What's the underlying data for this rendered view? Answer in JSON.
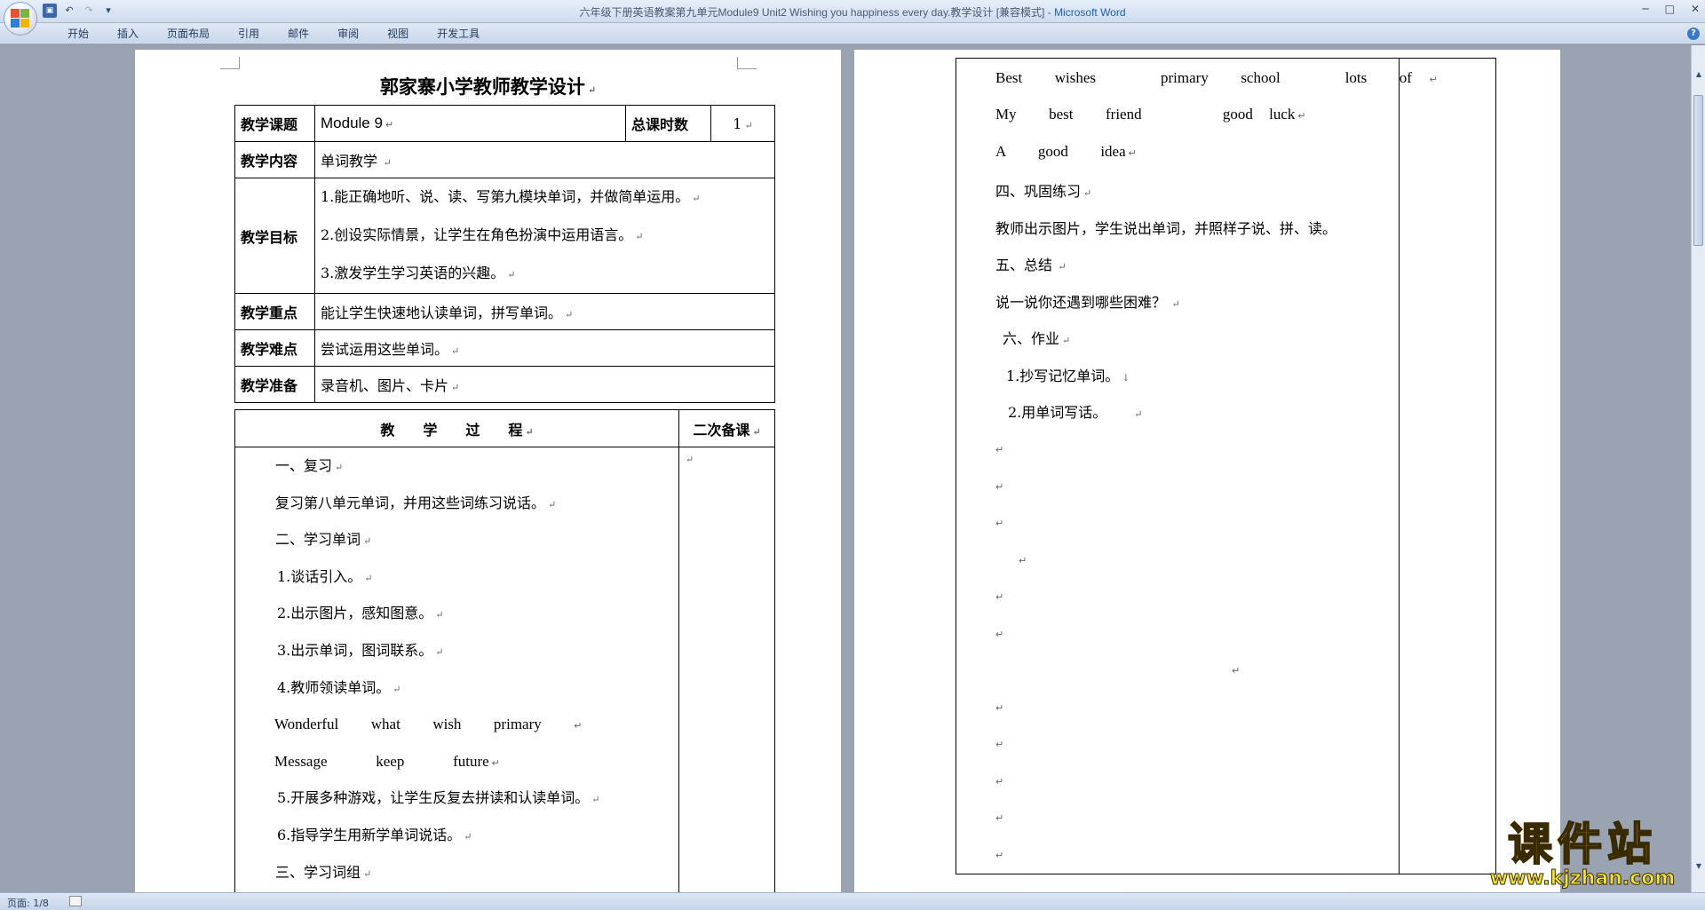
{
  "window": {
    "title_doc": "六年级下册英语教案第九单元Module9 Unit2 Wishing you happiness every day.教学设计 [兼容模式] - ",
    "title_app": "Microsoft Word",
    "minimize": "─",
    "maximize": "□",
    "close": "✕"
  },
  "quick_access": {
    "save_icon": "save-icon",
    "undo_glyph": "↶",
    "redo_glyph": "↷",
    "more_glyph": "▾"
  },
  "ribbon": {
    "tabs": [
      "开始",
      "插入",
      "页面布局",
      "引用",
      "邮件",
      "审阅",
      "视图",
      "开发工具"
    ],
    "help": "?"
  },
  "status": {
    "page": "页面: 1/8"
  },
  "left_page": {
    "doc_title": "郭家寨小学教师教学设计",
    "lesson_label": "教学课题",
    "lesson_value": "Module 9",
    "total_hours_label": "总课时数",
    "total_hours_value": "1",
    "content_label": "教学内容",
    "content_value": "单词教学",
    "goal_label": "教学目标",
    "goals": [
      "1.能正确地听、说、读、写第九模块单词，并做简单运用。",
      "2.创设实际情景，让学生在角色扮演中运用语言。",
      "3.激发学生学习英语的兴趣。"
    ],
    "key_label": "教学重点",
    "key_value": "能让学生快速地认读单词，拼写单词。",
    "difficulty_label": "教学难点",
    "difficulty_value": "尝试运用这些单词。",
    "prep_label": "教学准备",
    "prep_value": "录音机、图片、卡片",
    "process_header": "教　　学　　过　　程",
    "second_prep_header": "二次备课",
    "process_lines": [
      "一、复习",
      "复习第八单元单词，并用这些词练习说话。",
      "二、学习单词",
      "1.谈话引入。",
      "2.出示图片，感知图意。",
      "3.出示单词，图词联系。",
      "4.教师领读单词。",
      "Wonderful  what  wish  primary",
      "Message   keep   future",
      "5.开展多种游戏，让学生反复去拼读和认读单词。",
      "6.指导学生用新学单词说话。",
      "三、学习词组"
    ]
  },
  "right_page": {
    "lines": [
      "Best  wishes    primary  school    lots  of",
      "My  best  friend     good luck",
      "A  good  idea",
      "四、巩固练习",
      "教师出示图片，学生说出单词，并照样子说、拼、读。",
      "五、总结",
      "说一说你还遇到哪些困难？",
      "六、作业",
      "1.抄写记忆单词。",
      "2.用单词写话。"
    ]
  },
  "watermark": {
    "cn": "课件站",
    "url": "www.kjzhan.com"
  }
}
